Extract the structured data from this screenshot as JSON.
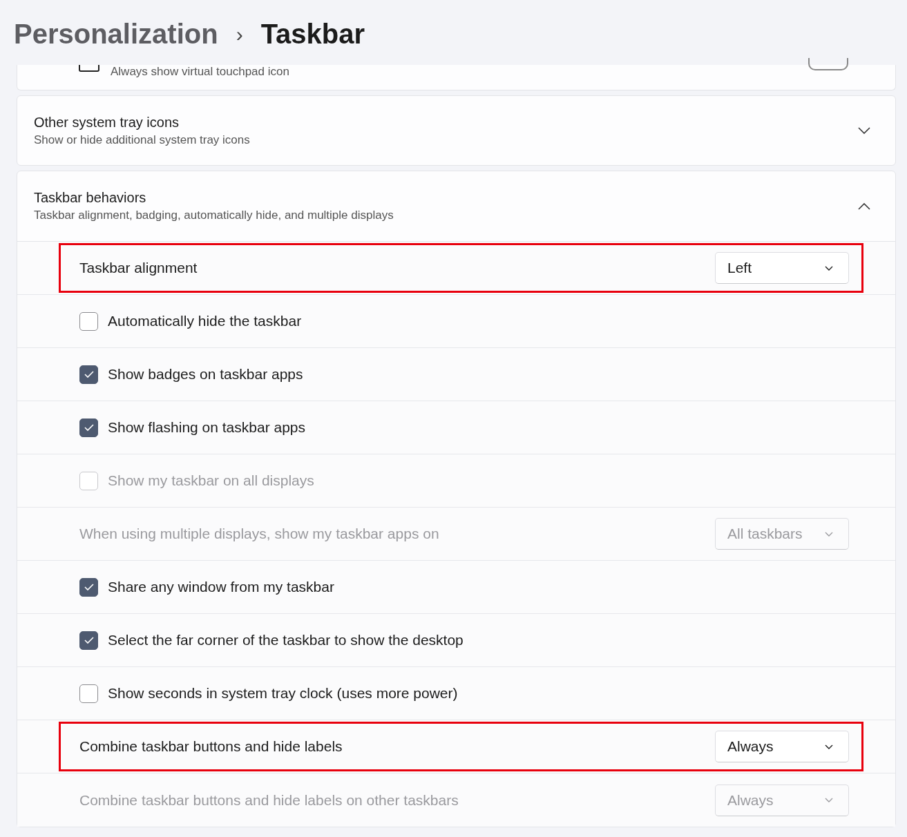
{
  "breadcrumb": {
    "parent": "Personalization",
    "separator": "›",
    "current": "Taskbar"
  },
  "partial_card": {
    "subtitle": "Always show virtual touchpad icon",
    "on": false
  },
  "tray_card": {
    "title": "Other system tray icons",
    "subtitle": "Show or hide additional system tray icons",
    "expanded": false
  },
  "behaviors": {
    "title": "Taskbar behaviors",
    "subtitle": "Taskbar alignment, badging, automatically hide, and multiple displays",
    "expanded": true,
    "rows": [
      {
        "kind": "dropdown",
        "label": "Taskbar alignment",
        "value": "Left",
        "disabled": false,
        "highlighted": true
      },
      {
        "kind": "checkbox",
        "label": "Automatically hide the taskbar",
        "checked": false,
        "disabled": false,
        "highlighted": false
      },
      {
        "kind": "checkbox",
        "label": "Show badges on taskbar apps",
        "checked": true,
        "disabled": false,
        "highlighted": false
      },
      {
        "kind": "checkbox",
        "label": "Show flashing on taskbar apps",
        "checked": true,
        "disabled": false,
        "highlighted": false
      },
      {
        "kind": "checkbox",
        "label": "Show my taskbar on all displays",
        "checked": false,
        "disabled": true,
        "highlighted": false
      },
      {
        "kind": "dropdown",
        "label": "When using multiple displays, show my taskbar apps on",
        "value": "All taskbars",
        "disabled": true,
        "highlighted": false
      },
      {
        "kind": "checkbox",
        "label": "Share any window from my taskbar",
        "checked": true,
        "disabled": false,
        "highlighted": false
      },
      {
        "kind": "checkbox",
        "label": "Select the far corner of the taskbar to show the desktop",
        "checked": true,
        "disabled": false,
        "highlighted": false
      },
      {
        "kind": "checkbox",
        "label": "Show seconds in system tray clock (uses more power)",
        "checked": false,
        "disabled": false,
        "highlighted": false
      },
      {
        "kind": "dropdown",
        "label": "Combine taskbar buttons and hide labels",
        "value": "Always",
        "disabled": false,
        "highlighted": true
      },
      {
        "kind": "dropdown",
        "label": "Combine taskbar buttons and hide labels on other taskbars",
        "value": "Always",
        "disabled": true,
        "highlighted": false
      }
    ]
  }
}
